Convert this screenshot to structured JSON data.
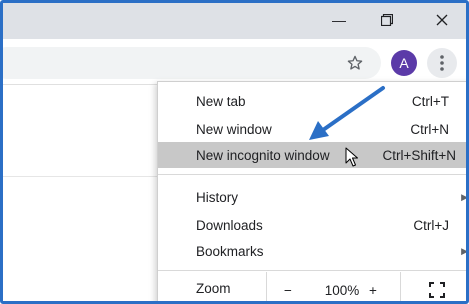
{
  "window": {
    "min_glyph": "—",
    "max_glyph": "❐",
    "close_glyph": "✕"
  },
  "toolbar": {
    "avatar_letter": "A",
    "star_icon": "star-icon",
    "menu_icon": "vertical-dots-icon"
  },
  "menu": {
    "items": [
      {
        "label": "New tab",
        "shortcut": "Ctrl+T"
      },
      {
        "label": "New window",
        "shortcut": "Ctrl+N"
      },
      {
        "label": "New incognito window",
        "shortcut": "Ctrl+Shift+N"
      }
    ],
    "nav_items": [
      {
        "label": "History"
      },
      {
        "label": "Downloads",
        "shortcut": "Ctrl+J"
      },
      {
        "label": "Bookmarks"
      }
    ],
    "zoom": {
      "label": "Zoom",
      "minus": "−",
      "value": "100%",
      "plus": "+",
      "fullscreen_icon": "fullscreen-icon"
    }
  },
  "colors": {
    "frame": "#2b6fc6",
    "arrow": "#2b6fc6",
    "avatar": "#5b3aa8",
    "highlight": "#c8c8c8"
  }
}
